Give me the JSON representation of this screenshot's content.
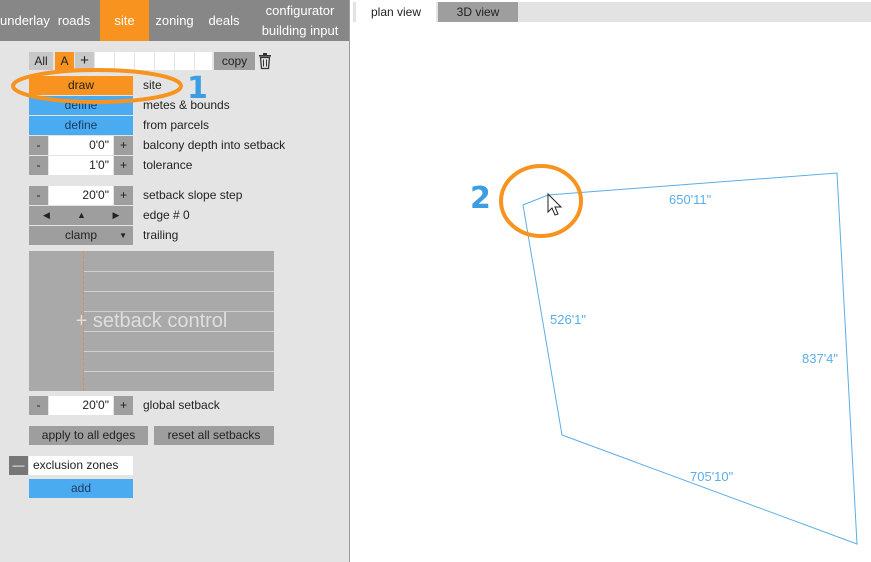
{
  "nav": {
    "tabs": [
      {
        "label": "underlay"
      },
      {
        "label": "roads"
      },
      {
        "label": "site"
      },
      {
        "label": "zoning"
      },
      {
        "label": "deals"
      }
    ],
    "configurator": "configurator",
    "building_input": "building input",
    "active": "site"
  },
  "variants": {
    "all": "All",
    "a": "A",
    "plus": "+",
    "copy": "copy"
  },
  "site": {
    "draw_button": "draw",
    "draw_label": "site",
    "metes_button": "define",
    "metes_label": "metes & bounds",
    "parcels_button": "define",
    "parcels_label": "from parcels"
  },
  "steppers": {
    "minus": "-",
    "plus": "+",
    "balcony_value": "0'0\"",
    "balcony_label": "balcony depth into setback",
    "tolerance_value": "1'0\"",
    "tolerance_label": "tolerance",
    "slope_value": "20'0\"",
    "slope_label": "setback slope step",
    "global_value": "20'0\"",
    "global_label": "global setback"
  },
  "edge": {
    "left": "◀",
    "up": "▲",
    "right": "▶",
    "label": "edge # 0",
    "mode": "clamp",
    "mode_label": "trailing"
  },
  "setback_control": {
    "label": "+ setback control"
  },
  "actions": {
    "apply_all": "apply to all edges",
    "reset_all": "reset all setbacks"
  },
  "exclusion": {
    "collapse": "—",
    "label": "exclusion zones",
    "add": "add"
  },
  "view": {
    "plan_tab": "plan view",
    "three_d_tab": "3D view",
    "active": "plan view"
  },
  "plan": {
    "dimensions": {
      "top": "650'11\"",
      "left": "526'1\"",
      "right": "837'4\"",
      "bottom": "705'10\""
    },
    "line_color": "#5aaee8"
  },
  "annotations": {
    "step1": "1",
    "step2": "2",
    "highlight_color": "#f7931e"
  },
  "colors": {
    "accent": "#f7931e",
    "blue": "#4aabf0",
    "nav_bg": "#878787"
  }
}
